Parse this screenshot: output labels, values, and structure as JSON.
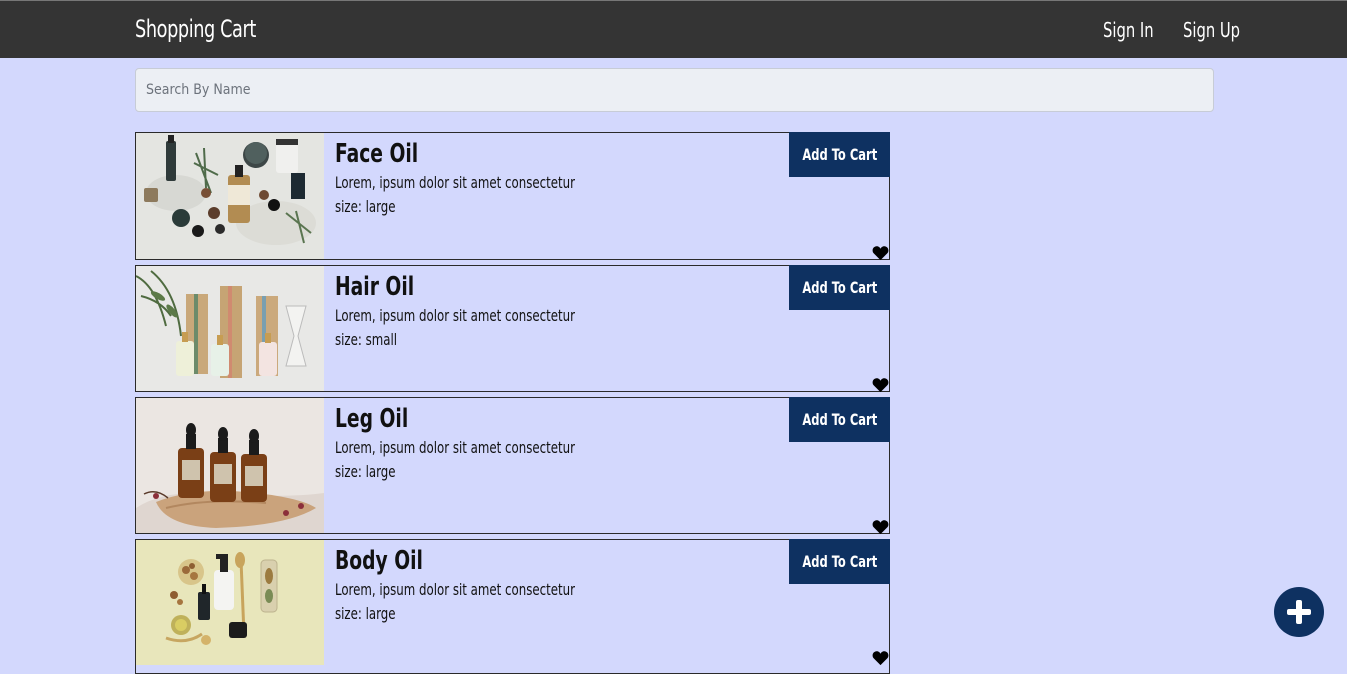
{
  "navbar": {
    "brand": "Shopping Cart",
    "sign_in": "Sign In",
    "sign_up": "Sign Up"
  },
  "search": {
    "placeholder": "Search By Name",
    "value": ""
  },
  "products": [
    {
      "title": "Face Oil",
      "description": "Lorem, ipsum dolor sit amet consectetur",
      "size": "size: large",
      "button": "Add To Cart"
    },
    {
      "title": "Hair Oil",
      "description": "Lorem, ipsum dolor sit amet consectetur",
      "size": "size: small",
      "button": "Add To Cart"
    },
    {
      "title": "Leg Oil",
      "description": "Lorem, ipsum dolor sit amet consectetur",
      "size": "size: large",
      "button": "Add To Cart"
    },
    {
      "title": "Body Oil",
      "description": "Lorem, ipsum dolor sit amet consectetur",
      "size": "size: large",
      "button": "Add To Cart"
    }
  ],
  "icons": {
    "favorite": "heart-icon",
    "add": "plus-icon"
  },
  "colors": {
    "page_background": "#d3d8fd",
    "navbar": "#343434",
    "button": "#0e3161"
  }
}
